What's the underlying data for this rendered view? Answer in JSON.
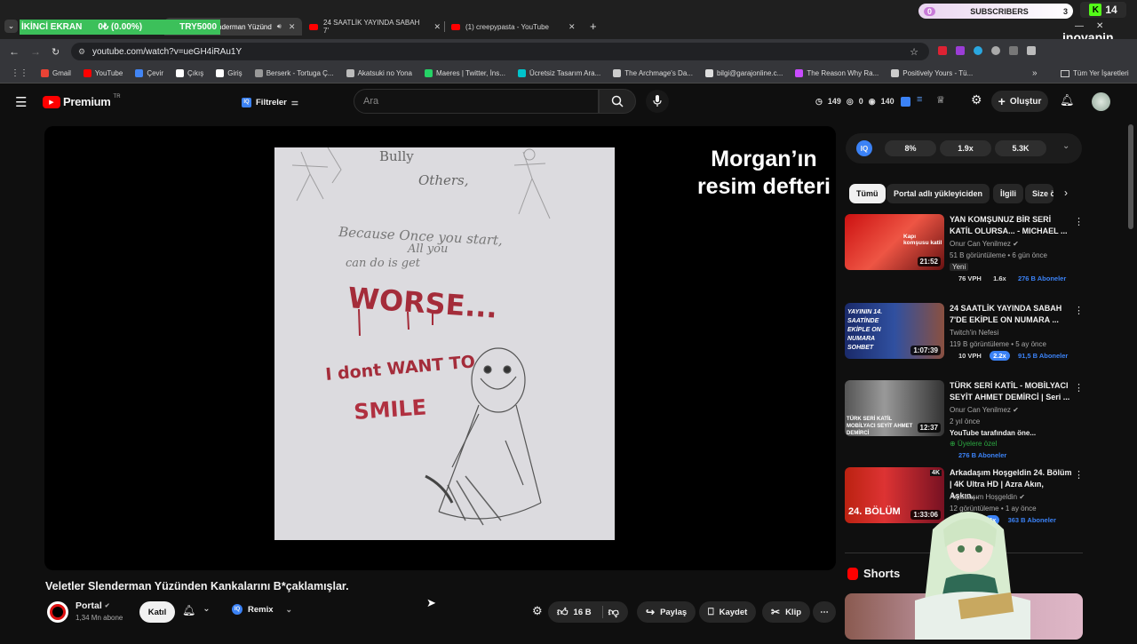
{
  "stream_overlay": {
    "screen_label": "İKİNCİ EKRAN",
    "progress": "0₺ (0.00%)",
    "goal": "TRY5000"
  },
  "tabs": [
    {
      "label": "nderman Yüzünd"
    },
    {
      "label": "24 SAATLİK YAYINDA SABAH 7'"
    },
    {
      "label": "(1) creepypasta - YouTube"
    }
  ],
  "subs_overlay": {
    "badge": "0",
    "label": "SUBSCRIBERS",
    "count": "3"
  },
  "kick_overlay": {
    "count": "14"
  },
  "brand_overlay": "inovapin",
  "address": {
    "url": "youtube.com/watch?v=ueGH4iRAu1Y"
  },
  "bookmarks": [
    {
      "label": "Gmail",
      "color": "#ea4335"
    },
    {
      "label": "YouTube",
      "color": "#ff0000"
    },
    {
      "label": "Çevir",
      "color": "#4285f4"
    },
    {
      "label": "Çıkış",
      "color": "#ffffff"
    },
    {
      "label": "Giriş",
      "color": "#ffffff"
    },
    {
      "label": "Berserk - Tortuga Ç...",
      "color": "#999999"
    },
    {
      "label": "Akatsuki no Yona",
      "color": "#bbbbbb"
    },
    {
      "label": "Maeres | Twitter, İns...",
      "color": "#25d366"
    },
    {
      "label": "Ücretsiz Tasarım Ara...",
      "color": "#00c4cc"
    },
    {
      "label": "The Archmage's Da...",
      "color": "#cccccc"
    },
    {
      "label": "bilgi@garajonline.c...",
      "color": "#dddddd"
    },
    {
      "label": "The Reason Why Ra...",
      "color": "#c94cff"
    },
    {
      "label": "Positively Yours - Tü...",
      "color": "#cccccc"
    }
  ],
  "bookmarks_all": "Tüm Yer İşaretleri",
  "yt": {
    "logo": "Premium",
    "logo_region": "TR",
    "filters": "Filtreler",
    "search_placeholder": "Ara",
    "stats": {
      "a": "149",
      "b": "0",
      "c": "140"
    },
    "create": "Oluştur"
  },
  "video": {
    "overlay_title_line1": "Morgan’ın",
    "overlay_title_line2": "resim defteri",
    "title": "Veletler Slenderman Yüzünden Kankalarını B*çaklamışlar.",
    "channel": "Portal",
    "subscribers": "1,34 Mn abone",
    "join": "Katıl",
    "remix": "Remix",
    "likes": "16 B",
    "share": "Paylaş",
    "save": "Kaydet",
    "clip": "Klip"
  },
  "sketch": {
    "top_words": "Bully",
    "others": "Others,",
    "line1": "Because Once you start,",
    "line2": "All you",
    "line3": "can do is get",
    "worse": "WORSE...",
    "dont_want": "I dont WANT TO",
    "smile": "SMILE"
  },
  "iq_panel": {
    "logo": "IQ",
    "a": "8%",
    "b": "1.9x",
    "c": "5.3K"
  },
  "filter_chips": [
    "Tümü",
    "Portal adlı yükleyiciden",
    "İlgili",
    "Size ö"
  ],
  "recommendations": [
    {
      "title": "YAN KOMŞUNUZ BİR SERİ KATİL OLURSA... - MICHAEL ...",
      "channel": "Onur Can Yenilmez",
      "meta": "51 B görüntüleme • 6 gün önce",
      "badge": "Yeni",
      "duration": "21:52",
      "thumb_text": "Kapı komşusu katil",
      "s1": "76 VPH",
      "s2": "1.6x",
      "s3": "276 B Aboneler"
    },
    {
      "title": "24 SAATLİK YAYINDA SABAH 7'DE EKİPLE ON NUMARA ...",
      "channel": "Twitch'in Nefesi",
      "meta": "119 B görüntüleme • 5 ay önce",
      "badge": "",
      "duration": "1:07:39",
      "thumb_text": "YAYININ 14. SAATİNDE EKİPLE ON NUMARA SOHBET",
      "s1": "10 VPH",
      "s2": "2.2x",
      "s3": "91,5 B Aboneler"
    },
    {
      "title": "TÜRK SERİ KATİL - MOBİLYACI SEYİT AHMET DEMİRCİ | Seri ...",
      "channel": "Onur Can Yenilmez",
      "meta": "2 yıl önce",
      "badge": "YouTube tarafından öne...",
      "duration": "12:37",
      "thumb_text": "TÜRK SERİ KATİL MOBİLYACI SEYİT AHMET DEMİRCİ",
      "s1": "Üyelere özel",
      "s2": "",
      "s3": "276 B Aboneler"
    },
    {
      "title": "Arkadaşım Hoşgeldin 24. Bölüm | 4K Ultra HD | Azra Akın, Aşkın...",
      "channel": "Arkadaşım Hoşgeldin",
      "meta": "12 görüntüleme • 1 ay önce",
      "badge": "",
      "duration": "1:33:06",
      "thumb_text": "24. BÖLÜM",
      "s1": "",
      "s2": "4x",
      "s3": "363 B Aboneler"
    }
  ],
  "shorts_label": "Shorts",
  "colors": {
    "accent": "#ff0000",
    "iq_blue": "#3b82f6",
    "stream_green": "#3cc05a",
    "chip_active": "#f1f1f1"
  }
}
